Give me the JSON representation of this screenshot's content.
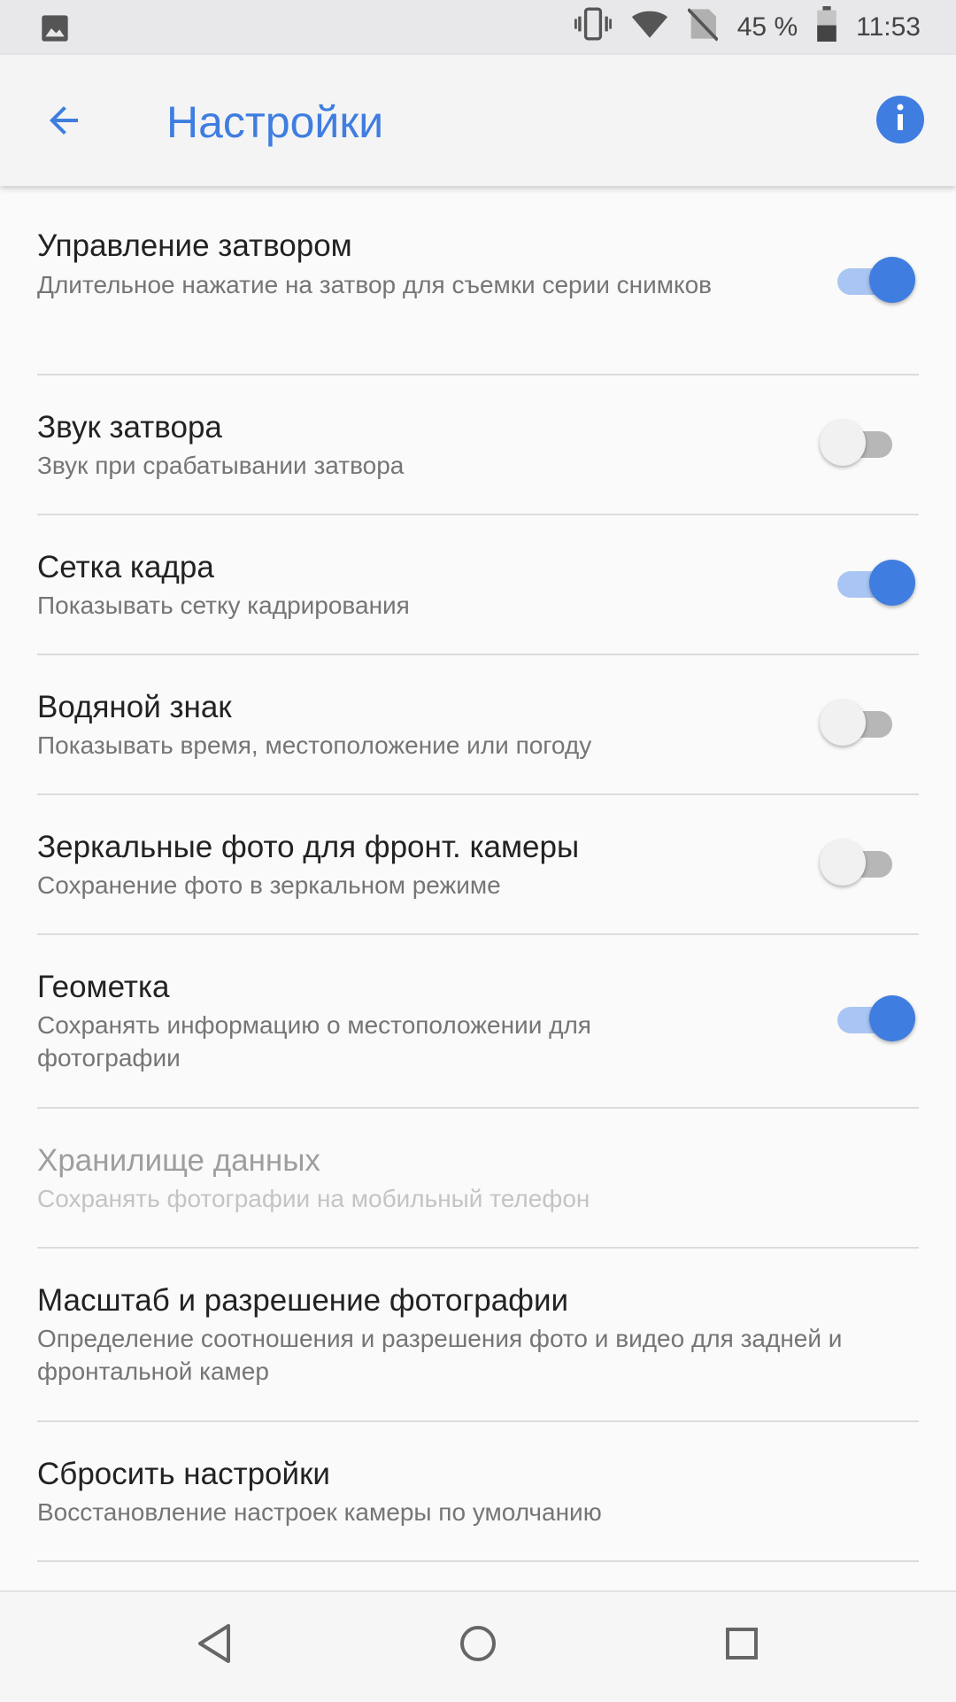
{
  "status_bar": {
    "battery": "45 %",
    "time": "11:53",
    "icons": [
      "image-icon",
      "vibrate-icon",
      "wifi-icon",
      "no-sim-icon",
      "battery-icon"
    ]
  },
  "app_bar": {
    "title": "Настройки",
    "back_icon": "arrow-back-icon",
    "info_icon": "info-icon",
    "accent_color": "#3f7de0"
  },
  "settings": [
    {
      "title": "Управление затвором",
      "subtitle": "Длительное нажатие на затвор для съемки серии снимков",
      "toggle": true
    },
    {
      "title": "Звук затвора",
      "subtitle": "Звук при срабатывании затвора",
      "toggle": false
    },
    {
      "title": "Сетка кадра",
      "subtitle": "Показывать сетку кадрирования",
      "toggle": true
    },
    {
      "title": "Водяной знак",
      "subtitle": "Показывать время, местоположение или погоду",
      "toggle": false
    },
    {
      "title": "Зеркальные фото для фронт. камеры",
      "subtitle": "Сохранение фото в зеркальном режиме",
      "toggle": false
    },
    {
      "title": "Геометка",
      "subtitle": "Сохранять информацию о местоположении для фотографии",
      "toggle": true
    },
    {
      "title": "Хранилище данных",
      "subtitle": "Сохранять фотографии на мобильный телефон",
      "disabled": true
    },
    {
      "title": "Масштаб и разрешение фотографии",
      "subtitle": "Определение соотношения и разрешения фото и видео для задней и фронтальной камер"
    },
    {
      "title": "Сбросить настройки",
      "subtitle": "Восстановление настроек камеры по умолчанию"
    }
  ],
  "nav_bar": {
    "icons": [
      "nav-back-icon",
      "nav-home-icon",
      "nav-recents-icon"
    ]
  }
}
